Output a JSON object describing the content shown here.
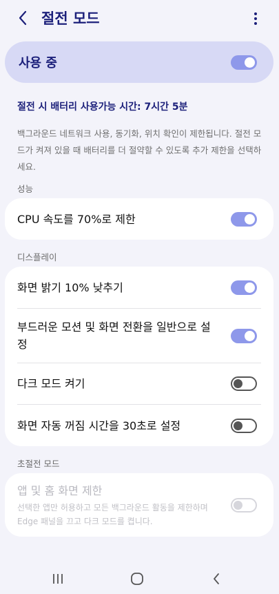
{
  "header": {
    "title": "절전 모드",
    "back_icon": "back-arrow-icon",
    "more_icon": "more-vert-icon"
  },
  "master": {
    "label": "사용 중",
    "on": true
  },
  "battery_time": "절전 시 배터리 사용가능 시간: 7시간 5분",
  "description": "백그라운드 네트워크 사용, 동기화, 위치 확인이 제한됩니다. 절전 모드가 켜져 있을 때 배터리를 더 절약할 수 있도록 추가 제한을 선택하세요.",
  "sections": {
    "performance": {
      "label": "성능",
      "items": [
        {
          "label": "CPU 속도를 70%로 제한",
          "on": true
        }
      ]
    },
    "display": {
      "label": "디스플레이",
      "items": [
        {
          "label": "화면 밝기 10% 낮추기",
          "on": true
        },
        {
          "label": "부드러운 모션 및 화면 전환을 일반으로 설정",
          "on": true
        },
        {
          "label": "다크 모드 켜기",
          "on": false
        },
        {
          "label": "화면 자동 꺼짐 시간을 30초로 설정",
          "on": false
        }
      ]
    },
    "ultra": {
      "label": "초절전 모드",
      "item": {
        "title": "앱 및 홈 화면 제한",
        "subtitle": "선택한 앱만 허용하고 모든 백그라운드 활동을 제한하며 Edge 패널을 끄고 다크 모드를 켭니다.",
        "enabled": false
      }
    }
  },
  "colors": {
    "accent": "#1b1f7a",
    "toggle_on": "#8e98ea",
    "master_bg": "#d7d9f5",
    "page_bg": "#f3f3fa"
  },
  "navbar": {
    "recents_icon": "recents-icon",
    "home_icon": "home-icon",
    "back_icon": "nav-back-icon"
  }
}
